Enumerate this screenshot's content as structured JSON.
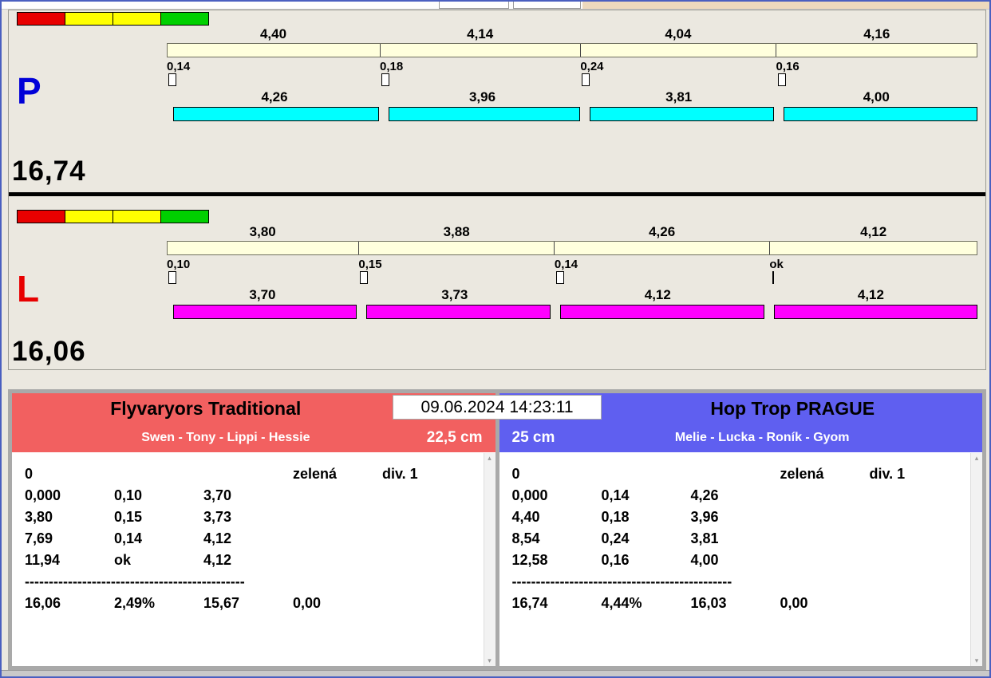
{
  "lanes": [
    {
      "letter": "P",
      "letter_color": "#0000d8",
      "total": "16,74",
      "strip_colors": [
        "#e80000",
        "#ffff00",
        "#ffff00",
        "#00d000"
      ],
      "split_values": [
        "4,40",
        "4,14",
        "4,04",
        "4,16"
      ],
      "change_values": [
        "0,14",
        "0,18",
        "0,24",
        "0,16"
      ],
      "change_marks": [
        "box",
        "box",
        "box",
        "box"
      ],
      "leg_values": [
        "4,26",
        "3,96",
        "3,81",
        "4,00"
      ],
      "bar_color": "#00ffff"
    },
    {
      "letter": "L",
      "letter_color": "#e80000",
      "total": "16,06",
      "strip_colors": [
        "#e80000",
        "#ffff00",
        "#ffff00",
        "#00d000"
      ],
      "split_values": [
        "3,80",
        "3,88",
        "4,26",
        "4,12"
      ],
      "change_values": [
        "0,10",
        "0,15",
        "0,14",
        "ok"
      ],
      "change_marks": [
        "box",
        "box",
        "box",
        "tick"
      ],
      "leg_values": [
        "3,70",
        "3,73",
        "4,12",
        "4,12"
      ],
      "bar_color": "#ff00ff"
    }
  ],
  "timestamp": "09.06.2024 14:23:11",
  "teams": [
    {
      "name": "Flyvaryors Traditional",
      "members": "Swen - Tony - Lippi - Hessie",
      "jump_height": "22,5 cm",
      "header_color": "#f26060",
      "result": {
        "start": "0",
        "lights": "zelená",
        "division": "div. 1",
        "rows": [
          [
            "0,000",
            "0,10",
            "3,70"
          ],
          [
            "3,80",
            "0,15",
            "3,73"
          ],
          [
            "7,69",
            "0,14",
            "4,12"
          ],
          [
            "11,94",
            "ok",
            "4,12"
          ]
        ],
        "separator": "----------------------------------------------",
        "totals": [
          "16,06",
          "2,49%",
          "15,67",
          "0,00"
        ]
      }
    },
    {
      "name": "Hop Trop PRAGUE",
      "members": "Melie - Lucka - Roník - Gyom",
      "jump_height": "25 cm",
      "header_color": "#5f5ff0",
      "result": {
        "start": "0",
        "lights": "zelená",
        "division": "div. 1",
        "rows": [
          [
            "0,000",
            "0,14",
            "4,26"
          ],
          [
            "4,40",
            "0,18",
            "3,96"
          ],
          [
            "8,54",
            "0,24",
            "3,81"
          ],
          [
            "12,58",
            "0,16",
            "4,00"
          ]
        ],
        "separator": "----------------------------------------------",
        "totals": [
          "16,74",
          "4,44%",
          "16,03",
          "0,00"
        ]
      }
    }
  ],
  "icons": {
    "scroll_up": "▴",
    "scroll_down": "▾"
  }
}
